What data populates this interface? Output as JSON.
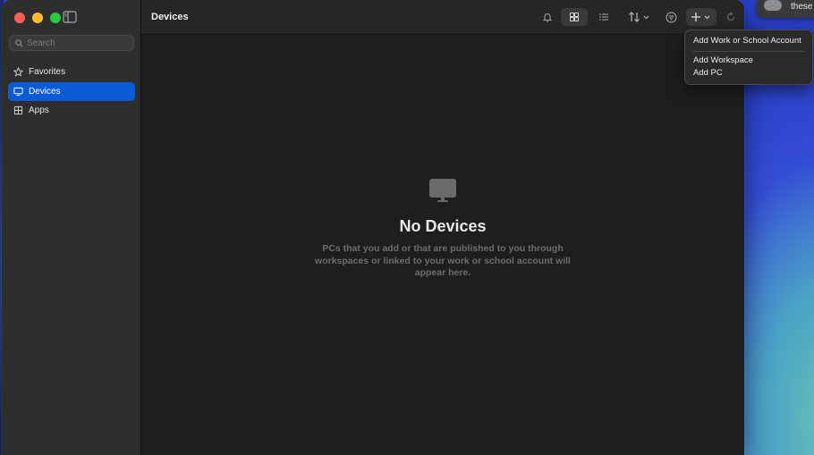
{
  "desktop": {
    "notification_peek": "these"
  },
  "sidebar": {
    "search": {
      "placeholder": "Search",
      "value": ""
    },
    "items": [
      {
        "label": "Favorites",
        "icon": "star-icon",
        "active": false
      },
      {
        "label": "Devices",
        "icon": "monitor-icon",
        "active": true
      },
      {
        "label": "Apps",
        "icon": "grid-icon",
        "active": false
      }
    ]
  },
  "toolbar": {
    "title": "Devices",
    "icons": [
      "bell-icon",
      "grid-view-icon",
      "list-view-icon",
      "sort-icon",
      "filter-icon",
      "add-icon",
      "refresh-icon"
    ]
  },
  "empty_state": {
    "icon": "monitor-icon",
    "title": "No Devices",
    "description": "PCs that you add or that are published to you through workspaces or linked to your work or school account will appear here."
  },
  "add_menu": {
    "items": [
      "Add Work or School Account",
      "Add Workspace",
      "Add PC"
    ]
  },
  "colors": {
    "accent": "#0a5bd6",
    "sidebar_bg": "#2e2e2e",
    "main_bg": "#1e1e1e"
  }
}
